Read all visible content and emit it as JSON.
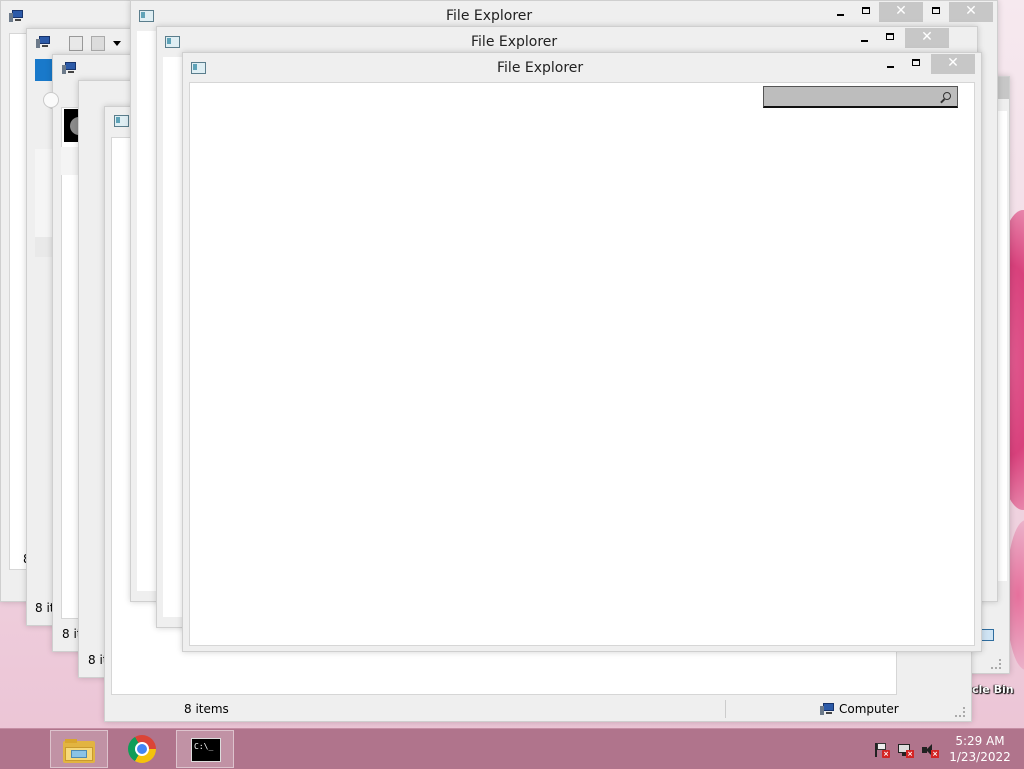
{
  "desktop": {
    "recycle_bin_label": "cle Bin"
  },
  "windows": [
    {
      "id": "w1",
      "title": "File Explorer",
      "status": "8"
    },
    {
      "id": "w2",
      "title": "File Explorer",
      "status": "8 it"
    },
    {
      "id": "w3",
      "title": "File Explorer",
      "status": "8 items"
    },
    {
      "id": "w4",
      "title": "File Explorer",
      "status": "8 it"
    },
    {
      "id": "w5",
      "title": "File Explorer",
      "status": "8 items",
      "location": "Computer"
    },
    {
      "id": "w6",
      "title": "File Explorer",
      "location": "puter"
    },
    {
      "id": "w7",
      "title": "File Explorer"
    },
    {
      "id": "w8",
      "title": "File Explorer"
    },
    {
      "id": "w9",
      "title": "File Explorer",
      "search_placeholder": ""
    }
  ],
  "taskbar": {
    "items": [
      {
        "name": "File Explorer",
        "icon": "folder-icon",
        "active": true
      },
      {
        "name": "Google Chrome",
        "icon": "chrome-icon",
        "active": false
      },
      {
        "name": "Command Prompt",
        "icon": "cmd-icon",
        "active": true,
        "glyph": "C:\\_"
      }
    ],
    "tray": {
      "icons": [
        "action-center-flag-icon",
        "network-icon",
        "volume-muted-icon"
      ],
      "time": "5:29 AM",
      "date": "1/23/2022"
    }
  },
  "colors": {
    "taskbar": "#b0748c",
    "close_button": "#c7c7c7",
    "desktop_background": "#f3e4ec"
  }
}
